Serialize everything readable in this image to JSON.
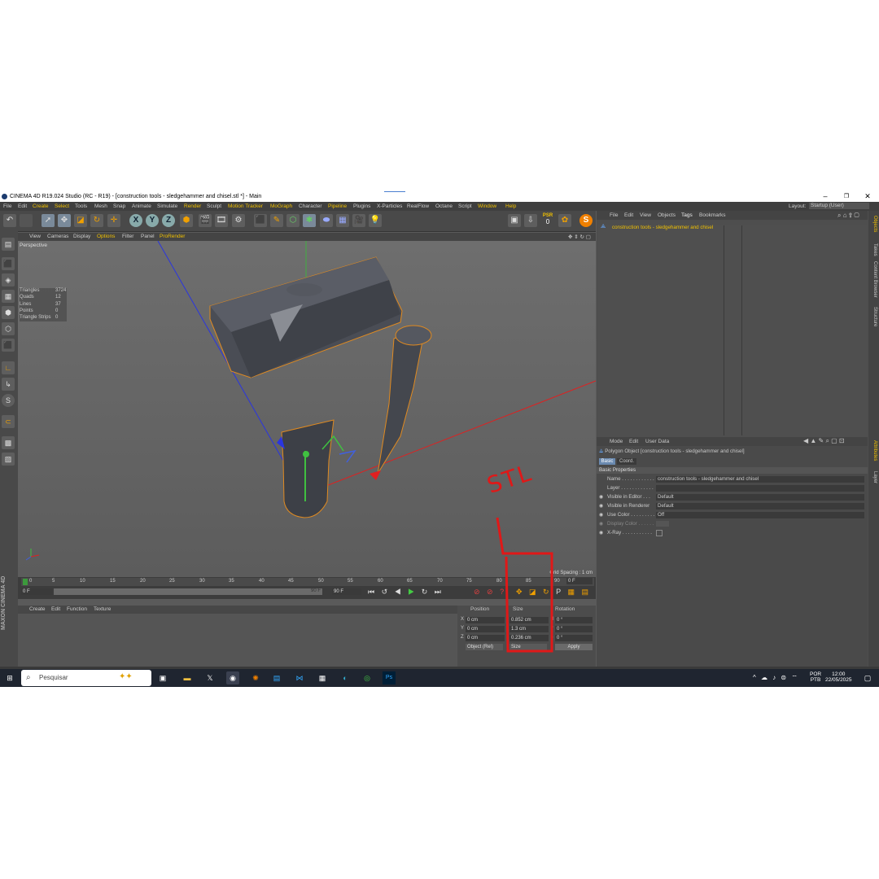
{
  "window": {
    "title": "CINEMA 4D R19.024 Studio (RC - R19) - [construction tools - sledgehammer and chisel.stl *] - Main",
    "minimize": "–",
    "maximize": "❐",
    "close": "✕"
  },
  "menu": [
    "File",
    "Edit",
    "Create",
    "Select",
    "Tools",
    "Mesh",
    "Snap",
    "Animate",
    "Simulate",
    "Render",
    "Sculpt",
    "Motion Tracker",
    "MoGraph",
    "Character",
    "Pipeline",
    "Plugins",
    "X-Particles",
    "RealFlow",
    "Octane",
    "Script",
    "Window",
    "Help"
  ],
  "layout": {
    "label": "Layout:",
    "value": "Startup (User)"
  },
  "toolbar": {
    "x": "X",
    "y": "Y",
    "z": "Z",
    "psr": "PSR",
    "psr_val": "0"
  },
  "viewport": {
    "menu": [
      "View",
      "Cameras",
      "Display",
      "Options",
      "Filter",
      "Panel",
      "ProRender"
    ],
    "label": "Perspective",
    "stats": [
      {
        "k": "Triangles",
        "v": "3724"
      },
      {
        "k": "Quads",
        "v": "12"
      },
      {
        "k": "Lines",
        "v": "37"
      },
      {
        "k": "Points",
        "v": "0"
      },
      {
        "k": "Triangle Strips",
        "v": "0"
      }
    ],
    "grid_spacing": "Grid Spacing : 1 cm"
  },
  "timeline": {
    "ticks": [
      "0",
      "5",
      "10",
      "15",
      "20",
      "25",
      "30",
      "35",
      "40",
      "45",
      "50",
      "55",
      "60",
      "65",
      "70",
      "75",
      "80",
      "85",
      "90"
    ],
    "frame_end_box": "0 F",
    "start": "0 F",
    "end_slider": "90 F",
    "end": "90 F"
  },
  "material_menu": [
    "Create",
    "Edit",
    "Function",
    "Texture"
  ],
  "coords": {
    "headers": [
      "Position",
      "Size",
      "Rotation"
    ],
    "axes": [
      "X",
      "Y",
      "Z"
    ],
    "rot_axes": [
      "H",
      "P",
      "B"
    ],
    "position": [
      "0 cm",
      "0 cm",
      "0 cm"
    ],
    "size": [
      "0.852 cm",
      "1.3 cm",
      "0.236 cm"
    ],
    "rotation": [
      "0 °",
      "0 °",
      "0 °"
    ],
    "mode": "Object (Rel)",
    "size_mode": "Size",
    "apply": "Apply"
  },
  "objects": {
    "menu": [
      "File",
      "Edit",
      "View",
      "Objects",
      "Tags",
      "Bookmarks"
    ],
    "item": "construction tools - sledgehammer and chisel"
  },
  "attributes": {
    "menu": [
      "Mode",
      "Edit",
      "User Data"
    ],
    "object_title": "Polygon Object [construction tools - sledgehammer and chisel]",
    "tabs": [
      "Basic",
      "Coord."
    ],
    "section": "Basic Properties",
    "rows": [
      {
        "label": "Name . . . . . . . . . . . .",
        "value": "construction tools - sledgehammer and chisel"
      },
      {
        "label": "Layer . . . . . . . . . . . .",
        "value": ""
      },
      {
        "label": "Visible in Editor . . .",
        "value": "Default"
      },
      {
        "label": "Visible in Renderer",
        "value": "Default"
      },
      {
        "label": "Use Color . . . . . . . . .",
        "value": "Off"
      },
      {
        "label": "Display Color . . . . . .",
        "value": ""
      },
      {
        "label": "X-Ray . . . . . . . . . . .",
        "value": ""
      }
    ]
  },
  "side_tabs_right": [
    "Objects",
    "Takes",
    "Content Browser",
    "Structure"
  ],
  "side_tabs_right2": [
    "Attributes",
    "Layer"
  ],
  "brand": {
    "line1": "MAXON",
    "line2": "CINEMA 4D"
  },
  "annotation": {
    "text": "STL",
    "color": "#e01818"
  },
  "taskbar": {
    "search_placeholder": "Pesquisar",
    "lang1": "POR",
    "lang2": "PTB",
    "time": "12:00",
    "date": "22/05/2025"
  }
}
